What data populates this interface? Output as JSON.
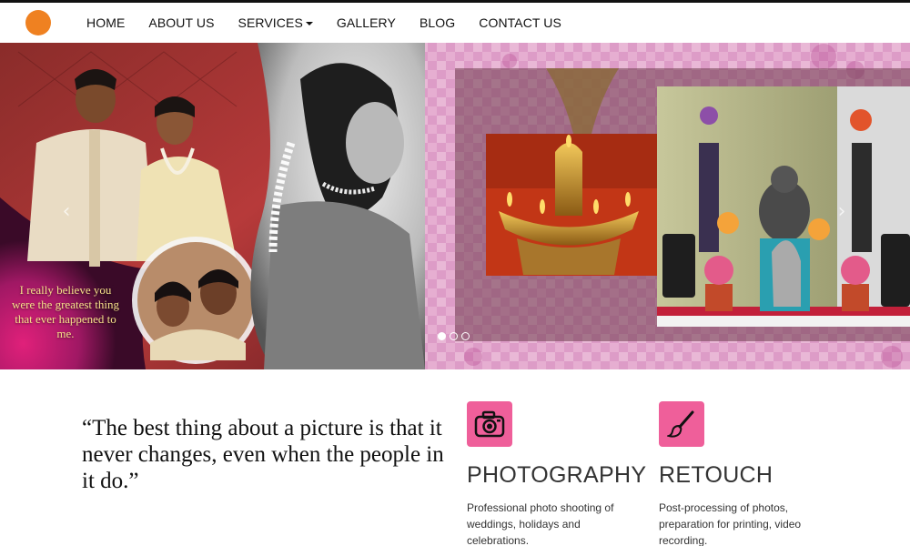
{
  "nav": {
    "items": [
      {
        "label": "HOME"
      },
      {
        "label": "ABOUT US"
      },
      {
        "label": "SERVICES"
      },
      {
        "label": "GALLERY"
      },
      {
        "label": "BLOG"
      },
      {
        "label": "CONTACT US"
      }
    ]
  },
  "hero": {
    "overlay_quote": "I really believe you were the greatest thing that ever happened to me.",
    "prev_arrow": "‹",
    "next_arrow": "›",
    "slides_count": 3,
    "active_slide": 1
  },
  "quote": {
    "text": "“The best thing about a picture is that it never changes, even when the people in it do.”"
  },
  "services": [
    {
      "title": "PHOTOGRAPHY",
      "icon": "camera-icon",
      "description": "Professional photo shooting of weddings, holidays and celebrations."
    },
    {
      "title": "RETOUCH",
      "icon": "brush-icon",
      "description": "Post-processing of photos, preparation for printing, video recording."
    }
  ],
  "colors": {
    "logo": "#ef8121",
    "icon_bg": "#ef5f9a",
    "text": "#333333"
  }
}
